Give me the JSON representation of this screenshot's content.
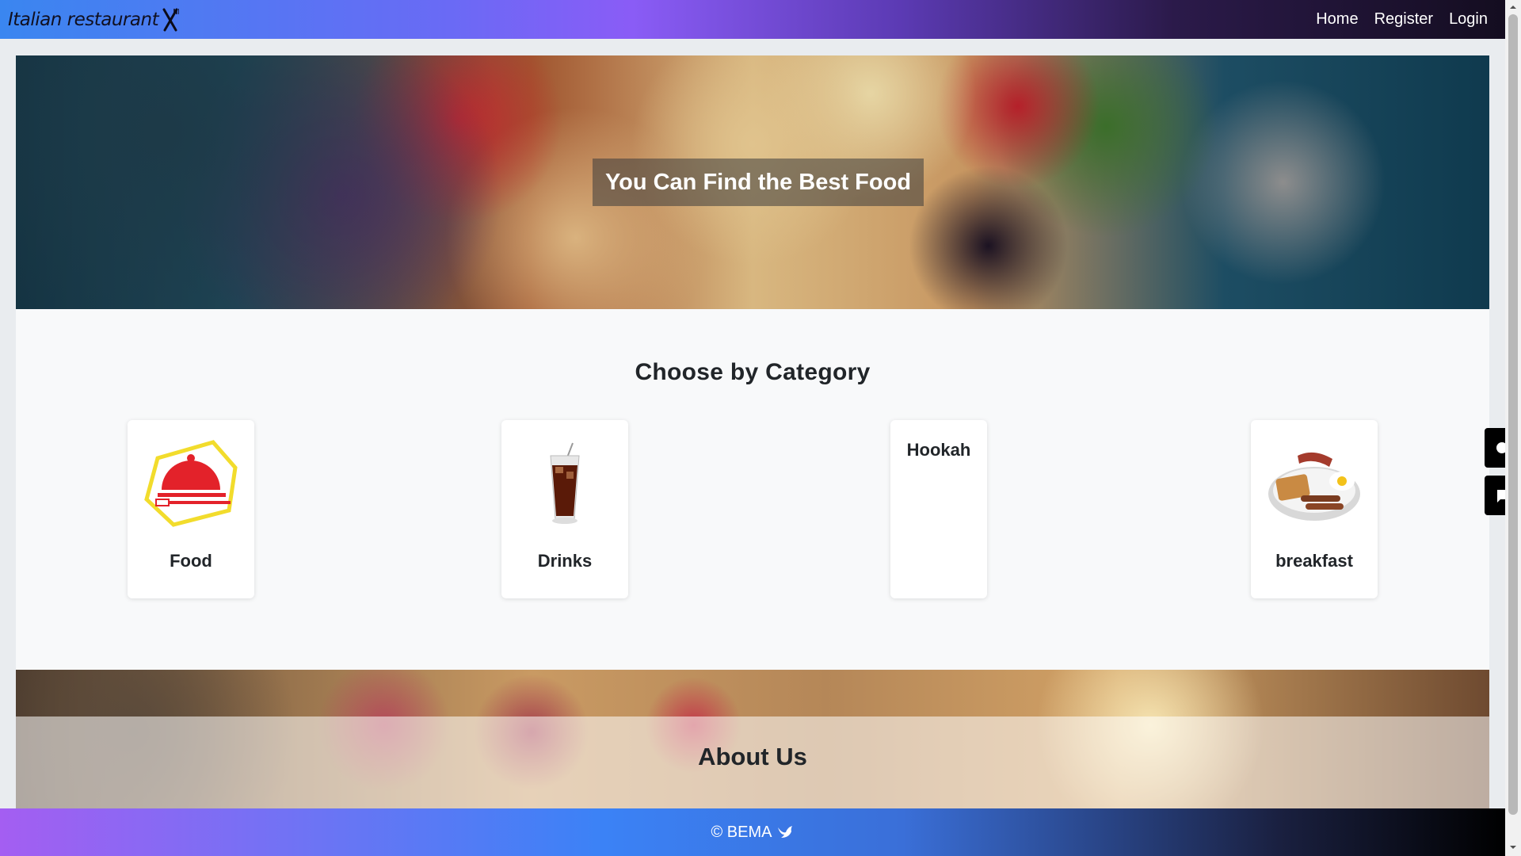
{
  "navbar": {
    "brand": "Italian restaurant",
    "links": [
      "Home",
      "Register",
      "Login"
    ]
  },
  "hero": {
    "caption": "You Can Find the Best Food"
  },
  "categories": {
    "title": "Choose by Category",
    "items": [
      {
        "label": "Food",
        "icon": "food-cloche-icon"
      },
      {
        "label": "Drinks",
        "icon": "drink-glass-icon"
      },
      {
        "label": "Hookah",
        "icon": ""
      },
      {
        "label": "breakfast",
        "icon": "breakfast-plate-icon"
      }
    ]
  },
  "about": {
    "title": "About Us"
  },
  "footer": {
    "text": "© BEMA"
  },
  "colors": {
    "nav_start": "#3a86f0",
    "nav_mid": "#8a5cf6",
    "nav_end": "#140d20",
    "footer_start": "#a45ef2",
    "footer_end": "#000000",
    "text": "#212529"
  }
}
